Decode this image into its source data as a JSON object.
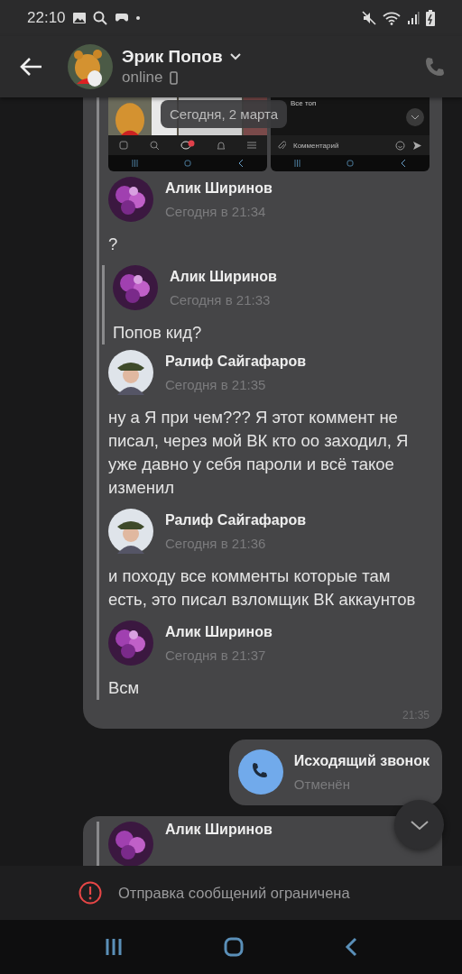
{
  "status_bar": {
    "time": "22:10"
  },
  "header": {
    "name": "Эрик Попов",
    "status": "online"
  },
  "date_pill": "Сегодня, 2 марта",
  "forwarded": {
    "screens": {
      "right_caption": "Все топ",
      "comment_placeholder": "Комментарий"
    },
    "messages": [
      {
        "author": "Алик Ширинов",
        "time": "Сегодня в 21:34",
        "avatar": {
          "kind": "blossom"
        },
        "text": "?",
        "quote": {
          "author": "Алик Ширинов",
          "time": "Сегодня в 21:33",
          "avatar": {
            "kind": "blossom"
          },
          "text": "Попов кид?"
        }
      },
      {
        "author": "Ралиф Сайгафаров",
        "time": "Сегодня в 21:35",
        "avatar": {
          "kind": "figure"
        },
        "text": "ну а Я при чем??? Я этот коммент не писал, через мой ВК кто оо заходил, Я уже давно у себя пароли и всё такое изменил"
      },
      {
        "author": "Ралиф Сайгафаров",
        "time": "Сегодня в 21:36",
        "avatar": {
          "kind": "figure"
        },
        "text": "и походу все комменты которые там есть, это писал взломщик ВК аккаунтов"
      },
      {
        "author": "Алик Ширинов",
        "time": "Сегодня в 21:37",
        "avatar": {
          "kind": "blossom"
        },
        "text": "Всм"
      }
    ],
    "time": "21:35"
  },
  "call": {
    "title": "Исходящий звонок",
    "status": "Отменён"
  },
  "partial_message": {
    "author": "Алик Ширинов",
    "avatar": {
      "kind": "blossom"
    }
  },
  "notice": "Отправка сообщений ограничена"
}
